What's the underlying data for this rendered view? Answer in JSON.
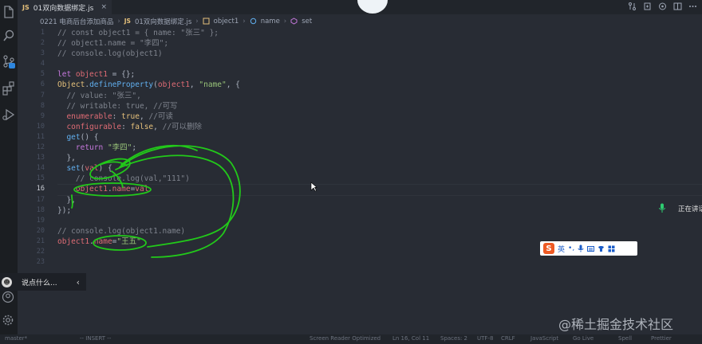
{
  "tab": {
    "lang": "JS",
    "filename": "01双向数据绑定.js",
    "close": "×"
  },
  "breadcrumb": {
    "folder": "0221 电商后台添加商品",
    "sep": "›",
    "file_lang": "JS",
    "file": "01双向数据绑定.js",
    "obj": "object1",
    "prop": "name",
    "method": "set"
  },
  "editor": {
    "line_numbers": [
      "1",
      "2",
      "3",
      "4",
      "5",
      "6",
      "7",
      "8",
      "9",
      "10",
      "11",
      "12",
      "13",
      "14",
      "15",
      "16",
      "17",
      "18",
      "19",
      "20",
      "21",
      "22",
      "23"
    ],
    "active_line": "16",
    "lines": [
      [
        {
          "t": "// const object1 = { name: \"张三\" };",
          "c": "cmt"
        }
      ],
      [
        {
          "t": "// object1.name = \"李四\";",
          "c": "cmt"
        }
      ],
      [
        {
          "t": "// console.log(object1)",
          "c": "cmt"
        }
      ],
      [],
      [
        {
          "t": "let ",
          "c": "kw"
        },
        {
          "t": "object1",
          "c": "var"
        },
        {
          "t": " = {};",
          "c": "pn"
        }
      ],
      [
        {
          "t": "Object",
          "c": "obj"
        },
        {
          "t": ".",
          "c": "pn"
        },
        {
          "t": "defineProperty",
          "c": "fn"
        },
        {
          "t": "(",
          "c": "pn"
        },
        {
          "t": "object1",
          "c": "var"
        },
        {
          "t": ", ",
          "c": "pn"
        },
        {
          "t": "\"name\"",
          "c": "str"
        },
        {
          "t": ", {",
          "c": "pn"
        }
      ],
      [
        {
          "t": "  // value: \"张三\",",
          "c": "cmt"
        }
      ],
      [
        {
          "t": "  // writable: true, //可写",
          "c": "cmt"
        }
      ],
      [
        {
          "t": "  ",
          "c": "pn"
        },
        {
          "t": "enumerable",
          "c": "var"
        },
        {
          "t": ": ",
          "c": "pn"
        },
        {
          "t": "true",
          "c": "obj"
        },
        {
          "t": ", ",
          "c": "pn"
        },
        {
          "t": "//可读",
          "c": "cmt"
        }
      ],
      [
        {
          "t": "  ",
          "c": "pn"
        },
        {
          "t": "configurable",
          "c": "var"
        },
        {
          "t": ": ",
          "c": "pn"
        },
        {
          "t": "false",
          "c": "obj"
        },
        {
          "t": ", ",
          "c": "pn"
        },
        {
          "t": "//可以删除",
          "c": "cmt"
        }
      ],
      [
        {
          "t": "  ",
          "c": "pn"
        },
        {
          "t": "get",
          "c": "fn"
        },
        {
          "t": "() {",
          "c": "pn"
        }
      ],
      [
        {
          "t": "    ",
          "c": "pn"
        },
        {
          "t": "return ",
          "c": "kw"
        },
        {
          "t": "\"李四\"",
          "c": "str"
        },
        {
          "t": ";",
          "c": "pn"
        }
      ],
      [
        {
          "t": "  },",
          "c": "pn"
        }
      ],
      [
        {
          "t": "  ",
          "c": "pn"
        },
        {
          "t": "set",
          "c": "fn"
        },
        {
          "t": "(",
          "c": "pn"
        },
        {
          "t": "val",
          "c": "var"
        },
        {
          "t": ") {",
          "c": "pn"
        }
      ],
      [
        {
          "t": "    // console.log(val,\"111\")",
          "c": "cmt"
        }
      ],
      [
        {
          "t": "    ",
          "c": "pn"
        },
        {
          "t": "object1",
          "c": "var"
        },
        {
          "t": ".",
          "c": "pn"
        },
        {
          "t": "name",
          "c": "var"
        },
        {
          "t": "=",
          "c": "pn"
        },
        {
          "t": "val",
          "c": "var"
        }
      ],
      [
        {
          "t": "  },",
          "c": "pn"
        }
      ],
      [
        {
          "t": "});",
          "c": "pn"
        }
      ],
      [],
      [
        {
          "t": "// console.log(object1.name)",
          "c": "cmt"
        }
      ],
      [
        {
          "t": "object1",
          "c": "var"
        },
        {
          "t": ".",
          "c": "pn"
        },
        {
          "t": "name",
          "c": "var"
        },
        {
          "t": "=",
          "c": "pn"
        },
        {
          "t": "\"王五\"",
          "c": "str"
        }
      ],
      [],
      []
    ]
  },
  "chat": {
    "placeholder": "说点什么...",
    "arrow": "‹"
  },
  "ime": {
    "logo": "S",
    "lang": "英",
    "dot": "•,"
  },
  "speaking": "正在讲话",
  "watermark": "@稀土掘金技术社区",
  "status": {
    "branch": "master*",
    "insert": "-- INSERT --",
    "screen_reader": "Screen Reader Optimized",
    "position": "Ln 16, Col 11",
    "spaces": "Spaces: 2",
    "encoding": "UTF-8",
    "eol": "CRLF",
    "language": "JavaScript",
    "golive": "Go Live",
    "spell": "Spell",
    "prettier": "Prettier"
  },
  "colors": {
    "bg": "#282c34",
    "annotation": "#22c91a",
    "ime_logo": "#ee5a24"
  }
}
